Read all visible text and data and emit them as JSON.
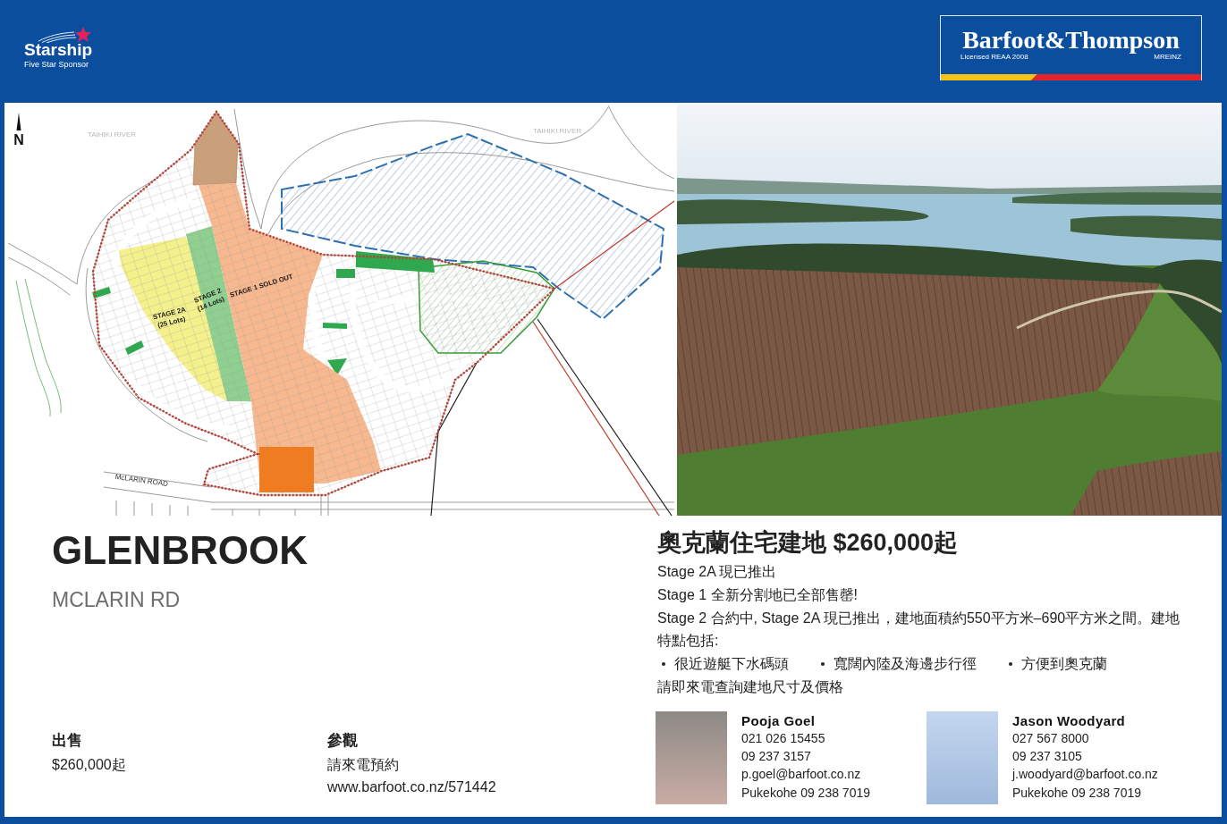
{
  "header": {
    "sponsor_logo": {
      "name": "Starship",
      "tagline": "Five Star Sponsor"
    },
    "agency_logo": {
      "name": "Barfoot&Thompson",
      "license": "Licensed REAA 2008",
      "membership": "MREINZ"
    }
  },
  "site_plan": {
    "north_label": "N",
    "labels": [
      {
        "kind": "river",
        "lines": [
          "TAIHIKI RIVER"
        ]
      },
      {
        "kind": "river",
        "lines": [
          "TAIHIKI RIVER"
        ]
      },
      {
        "kind": "stage",
        "lines": [
          "STAGE 2A",
          "(25 Lots)"
        ]
      },
      {
        "kind": "stage",
        "lines": [
          "STAGE 2",
          "(14 Lots)"
        ]
      },
      {
        "kind": "stage",
        "lines": [
          "STAGE 1 SOLD OUT"
        ]
      },
      {
        "kind": "road",
        "lines": [
          "McLARIN ROAD"
        ]
      }
    ]
  },
  "listing": {
    "title": "GLENBROOK",
    "subtitle": "MCLARIN RD",
    "details": [
      {
        "label": "出售",
        "lines": [
          "$260,000起"
        ]
      },
      {
        "label": "參觀",
        "lines": [
          "請來電預約",
          "www.barfoot.co.nz/571442"
        ]
      }
    ]
  },
  "description": {
    "heading": "奧克蘭住宅建地 $260,000起",
    "paragraphs": [
      "Stage 2A 現已推出",
      "Stage 1 全新分割地已全部售罄!",
      "Stage 2 合約中, Stage 2A 現已推出，建地面積約550平方米–690平方米之間。建地特點包括:"
    ],
    "bullets": [
      "很近遊艇下水碼頭",
      "寬闊內陸及海邊步行徑",
      "方便到奧克蘭"
    ],
    "closing": "請即來電查詢建地尺寸及價格"
  },
  "agents": [
    {
      "name": "Pooja Goel",
      "lines": [
        "021 026 15455",
        "09 237 3157",
        "p.goel@barfoot.co.nz",
        "Pukekohe 09 238 7019"
      ]
    },
    {
      "name": "Jason Woodyard",
      "lines": [
        "027 567 8000",
        "09 237 3105",
        "j.woodyard@barfoot.co.nz",
        "Pukekohe 09 238 7019"
      ]
    }
  ]
}
